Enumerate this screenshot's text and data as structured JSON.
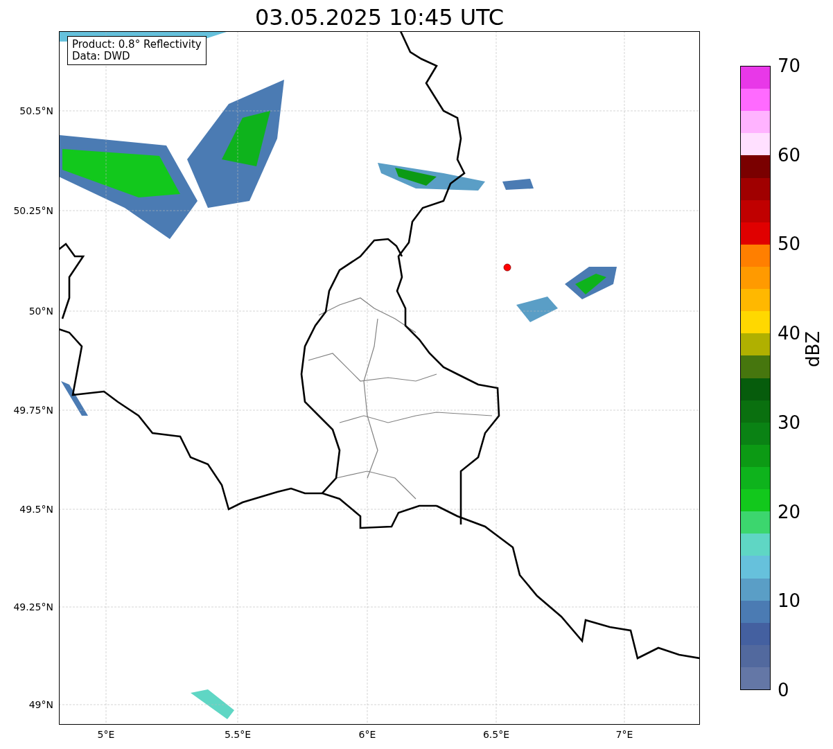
{
  "title": "03.05.2025 10:45 UTC",
  "map": {
    "info_lines": [
      "Product: 0.8° Reflectivity",
      "Data: DWD"
    ],
    "x_ticks": [
      "5°E",
      "5.5°E",
      "6°E",
      "6.5°E",
      "7°E"
    ],
    "y_ticks": [
      "50.5°N",
      "50.25°N",
      "50°N",
      "49.75°N",
      "49.5°N",
      "49.25°N",
      "49°N"
    ]
  },
  "colorbar": {
    "label": "dBZ",
    "ticks": [
      "70",
      "60",
      "50",
      "40",
      "30",
      "20",
      "10",
      "0"
    ],
    "bins": [
      {
        "color": "#e838e8"
      },
      {
        "color": "#ff6aff"
      },
      {
        "color": "#ffb3ff"
      },
      {
        "color": "#ffe0ff"
      },
      {
        "color": "#7a0000"
      },
      {
        "color": "#a00000"
      },
      {
        "color": "#c00000"
      },
      {
        "color": "#e00000"
      },
      {
        "color": "#ff7f00"
      },
      {
        "color": "#ff9a00"
      },
      {
        "color": "#ffb800"
      },
      {
        "color": "#ffd800"
      },
      {
        "color": "#b0b000"
      },
      {
        "color": "#46760e"
      },
      {
        "color": "#065c0c"
      },
      {
        "color": "#0a700f"
      },
      {
        "color": "#0a8214"
      },
      {
        "color": "#0c9a14"
      },
      {
        "color": "#0eb31c"
      },
      {
        "color": "#12c81c"
      },
      {
        "color": "#3cd66e"
      },
      {
        "color": "#5fd6c4"
      },
      {
        "color": "#66c1dc"
      },
      {
        "color": "#5a9ec6"
      },
      {
        "color": "#4b7bb3"
      },
      {
        "color": "#4460a0"
      },
      {
        "color": "#52699e"
      },
      {
        "color": "#6477a6"
      }
    ]
  }
}
